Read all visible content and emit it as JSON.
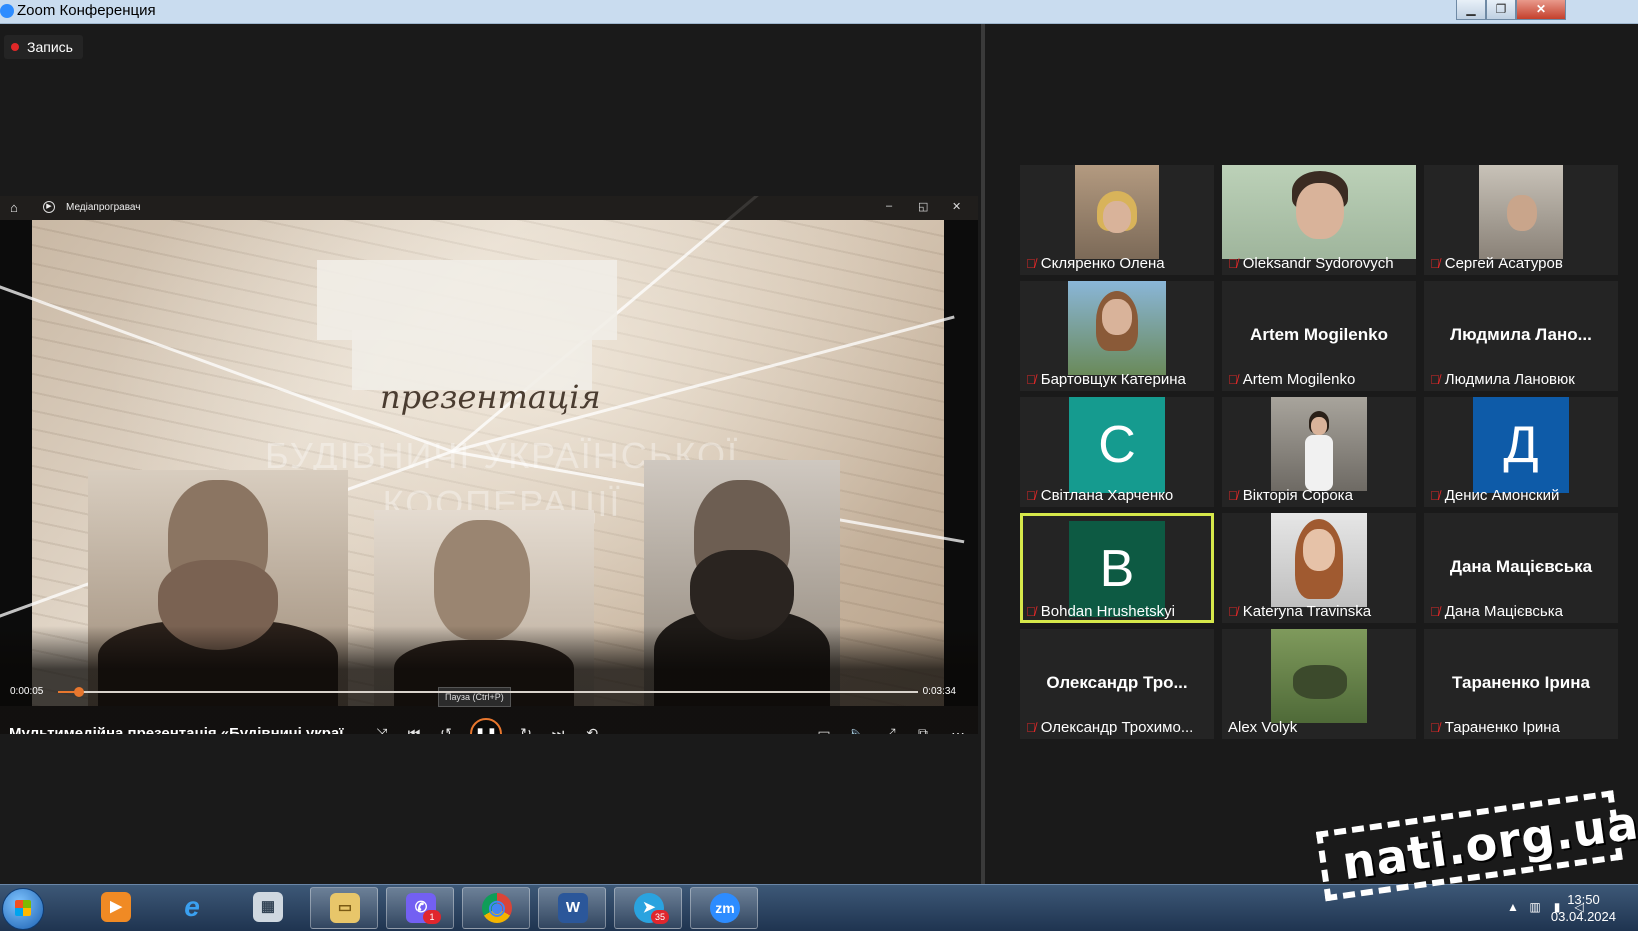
{
  "window": {
    "title": "Zoom Конференция",
    "controls": {
      "minimize": "▁",
      "restore": "❐",
      "close": "✕"
    }
  },
  "recording": {
    "label": "Запись",
    "color": "#e02828"
  },
  "player": {
    "app_name": "Медіапрогравач",
    "slide_title": "презентація",
    "slide_ghost_text": "БУДІВНИЧІ УКРАЇНСЬКОЇ КООПЕРАЦІЇ",
    "current_time": "0:00:05",
    "total_time": "0:03:34",
    "progress_fraction": 0.024,
    "media_title": "Мультимедійна презентація «Будівничі украї...",
    "pause_tooltip": "Пауза (Ctrl+P)",
    "accent_color": "#e8772e",
    "buttons": [
      "shuffle-icon",
      "previous-icon",
      "rewind-icon",
      "pause-icon",
      "forward-icon",
      "next-icon",
      "repeat-off-icon",
      "subtitles-icon",
      "volume-icon",
      "fullscreen-icon",
      "miniplayer-icon",
      "more-icon"
    ]
  },
  "participants": [
    {
      "name": "Скляренко Олена",
      "kind": "video",
      "muted": true
    },
    {
      "name": "Oleksandr Sydorovych",
      "kind": "video",
      "muted": true
    },
    {
      "name": "Сергей Асатуров",
      "kind": "video",
      "muted": true
    },
    {
      "name": "Бартовщук Катерина",
      "kind": "video",
      "muted": true
    },
    {
      "name": "Artem Mogilenko",
      "display": "Artem Mogilenko",
      "kind": "text",
      "muted": true
    },
    {
      "name": "Людмила Лановюк",
      "display": "Людмила  Лано...",
      "kind": "text",
      "muted": true
    },
    {
      "name": "Світлана Харченко",
      "kind": "avatar",
      "initial": "С",
      "color": "#159b8f",
      "muted": true
    },
    {
      "name": "Вікторія Сорока",
      "kind": "video",
      "muted": true
    },
    {
      "name": "Денис Амонский",
      "kind": "avatar",
      "initial": "Д",
      "color": "#0e5ba8",
      "muted": true
    },
    {
      "name": "Bohdan Hrushetskyi",
      "kind": "avatar",
      "initial": "B",
      "color": "#0d5a43",
      "muted": true,
      "active_speaker": true
    },
    {
      "name": "Kateryna Travinska",
      "kind": "video",
      "muted": true
    },
    {
      "name": "Дана Мацієвська",
      "display": "Дана Мацієвська",
      "kind": "text",
      "muted": true
    },
    {
      "name": "Олександр Трохимо...",
      "display": "Олександр  Тро...",
      "kind": "text",
      "muted": true
    },
    {
      "name": "Alex Volyk",
      "kind": "video",
      "muted": false
    },
    {
      "name": "Тараненко Ірина",
      "display": "Тараненко Ірина",
      "kind": "text",
      "muted": true
    }
  ],
  "taskbar": {
    "apps": [
      {
        "name": "media-player-icon",
        "label": "▶"
      },
      {
        "name": "internet-explorer-icon",
        "label": "e"
      },
      {
        "name": "calculator-icon",
        "label": "▦"
      },
      {
        "name": "file-explorer-icon",
        "label": "▭"
      },
      {
        "name": "viber-icon",
        "label": "✆",
        "badge": "1"
      },
      {
        "name": "chrome-icon",
        "label": "◉"
      },
      {
        "name": "word-icon",
        "label": "W"
      },
      {
        "name": "telegram-icon",
        "label": "➤",
        "badge": "35"
      },
      {
        "name": "zoom-icon",
        "label": "zm"
      }
    ],
    "clock_time": "13:50",
    "clock_date": "03.04.2024"
  },
  "watermark": {
    "text": "nati.org.ua"
  }
}
